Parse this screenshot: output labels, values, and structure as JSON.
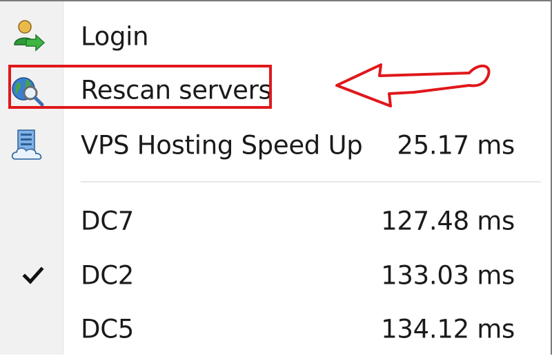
{
  "menu": {
    "items": [
      {
        "label": "Login",
        "icon": "login-user-icon",
        "value": ""
      },
      {
        "label": "Rescan servers",
        "icon": "globe-search-icon",
        "value": ""
      },
      {
        "label": "VPS Hosting Speed Up",
        "icon": "cloud-server-icon",
        "value": "25.17 ms"
      }
    ],
    "servers": [
      {
        "label": "DC7",
        "value": "127.48 ms",
        "checked": false
      },
      {
        "label": "DC2",
        "value": "133.03 ms",
        "checked": true
      },
      {
        "label": "DC5",
        "value": "134.12 ms",
        "checked": false
      }
    ]
  },
  "annotation": {
    "highlight_color": "#e0171b"
  }
}
